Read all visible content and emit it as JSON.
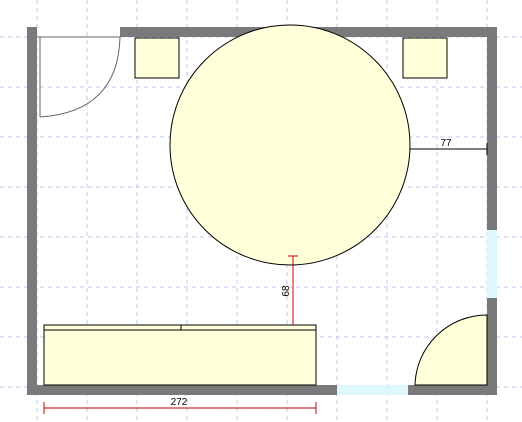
{
  "floorplan": {
    "dimensions": {
      "circle_to_wall": "77",
      "circle_to_bench": "68",
      "bench_width": "272"
    },
    "colors": {
      "furniture_fill": "#FFFFD9",
      "wall": "#7A7A7A",
      "window": "#DDF7FC",
      "grid": "#BFC6F2",
      "dim_red": "#CC0000"
    }
  }
}
